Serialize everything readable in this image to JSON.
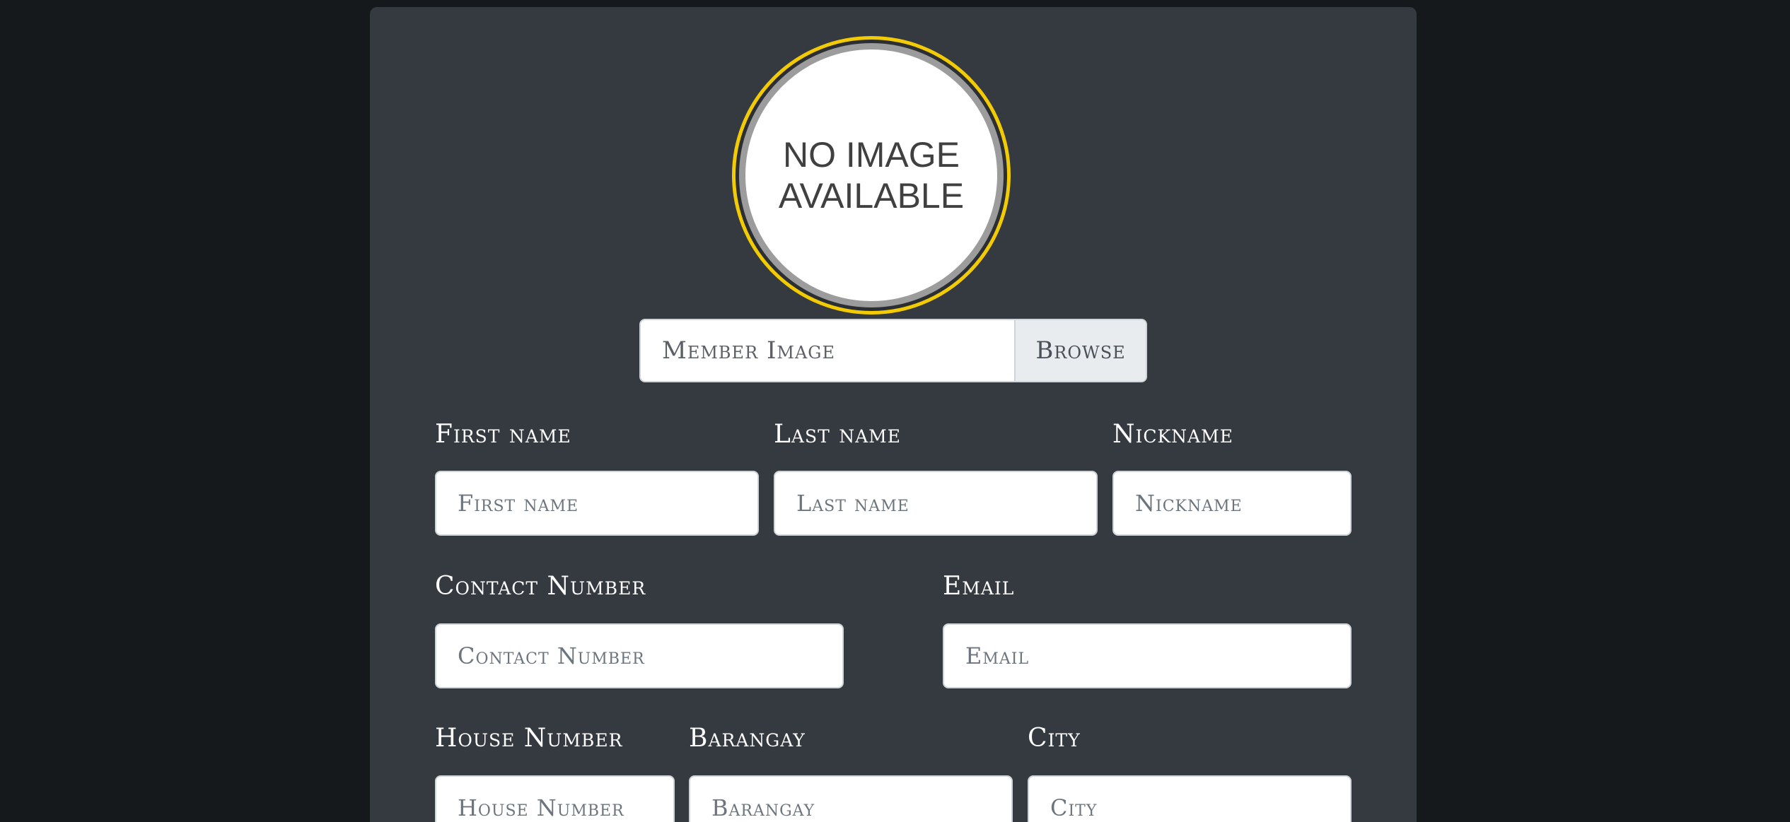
{
  "avatar": {
    "text": "NO IMAGE AVAILABLE",
    "ring_color": "#f2cb05"
  },
  "member_image": {
    "label": "Member Image",
    "browse_label": "Browse"
  },
  "fields": {
    "first_name": {
      "label": "First name",
      "placeholder": "First name"
    },
    "last_name": {
      "label": "Last name",
      "placeholder": "Last name"
    },
    "nickname": {
      "label": "Nickname",
      "placeholder": "Nickname"
    },
    "contact_number": {
      "label": "Contact Number",
      "placeholder": "Contact Number"
    },
    "email": {
      "label": "Email",
      "placeholder": "Email"
    },
    "house_number": {
      "label": "House Number",
      "placeholder": "House Number"
    },
    "barangay": {
      "label": "Barangay",
      "placeholder": "Barangay"
    },
    "city": {
      "label": "City",
      "placeholder": "City"
    }
  },
  "colors": {
    "page_background": "#16191c",
    "card_background": "#343a40",
    "accent": "#f2cb05"
  }
}
